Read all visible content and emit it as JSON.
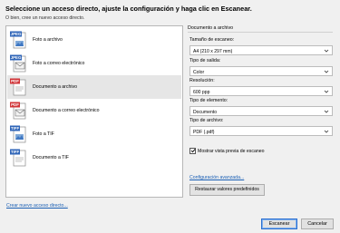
{
  "header": {
    "title": "Seleccione un acceso directo, ajuste la configuración y haga clic en Escanear.",
    "subtitle": "O bien, cree un nuevo acceso directo."
  },
  "shortcuts": [
    {
      "label": "Foto a archivo",
      "icon": "jpeg-icon",
      "badge": "JPEG",
      "badge_color": "#2f65b8"
    },
    {
      "label": "Foto a correo electrónico",
      "icon": "jpeg-icon",
      "badge": "JPEG",
      "badge_color": "#2f65b8"
    },
    {
      "label": "Documento a archivo",
      "icon": "pdf-icon",
      "badge": "PDF",
      "badge_color": "#d13438"
    },
    {
      "label": "Documento a correo electrónico",
      "icon": "pdf-icon",
      "badge": "PDF",
      "badge_color": "#d13438"
    },
    {
      "label": "Foto a TIF",
      "icon": "tiff-icon",
      "badge": "TIFF",
      "badge_color": "#2f65b8"
    },
    {
      "label": "Documento a TIF",
      "icon": "tiff-icon",
      "badge": "TIFF",
      "badge_color": "#2f65b8"
    }
  ],
  "selected_shortcut": "Documento a archivo",
  "create_link": "Crear nuevo acceso directo...",
  "settings": {
    "group_title": "Documento a archivo",
    "fields": [
      {
        "label": "Tamaño de escaneo:",
        "value": "A4 (210 x 297 mm)"
      },
      {
        "label": "Tipo de salida:",
        "value": "Color"
      },
      {
        "label": "Resolución:",
        "value": "600 ppp"
      },
      {
        "label": "Tipo de elemento:",
        "value": "Documento"
      },
      {
        "label": "Tipo de archivo:",
        "value": "PDF (.pdf)"
      }
    ],
    "preview_checkbox_label": "Mostrar vista previa de escaneo",
    "preview_checked": true,
    "advanced_link": "Configuración avanzada...",
    "restore_button": "Restaurar valores predefinidos"
  },
  "footer": {
    "scan_button": "Escanear",
    "cancel_button": "Cancelar"
  },
  "colors": {
    "accent": "#1a5fb4",
    "selection": "#e6e6e6",
    "pdf_red": "#d13438",
    "image_blue": "#2f65b8"
  }
}
